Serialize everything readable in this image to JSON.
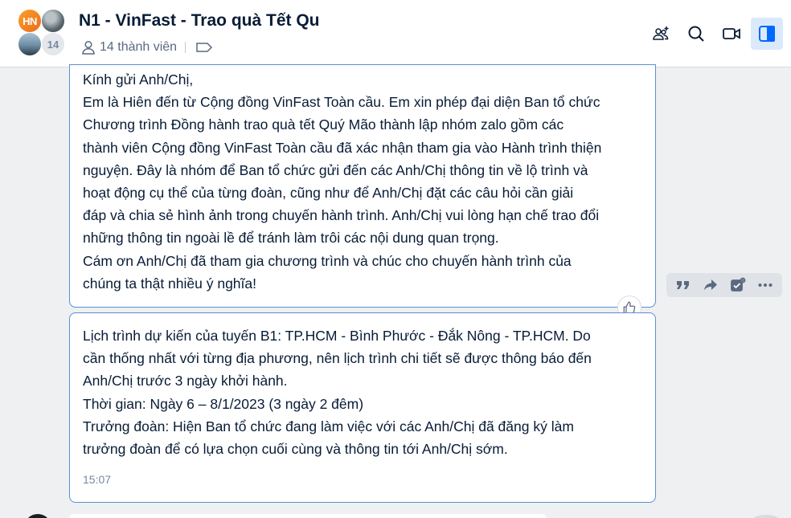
{
  "header": {
    "avatar_initials": "HN",
    "member_badge": "14",
    "title": "N1 - VinFast - Trao quà Tết Qu",
    "members_label": "14 thành viên",
    "accent_color": "#0068ff"
  },
  "messages": [
    {
      "lines": [
        "Kính gửi Anh/Chị,",
        "Em là Hiên đến từ Cộng đồng VinFast Toàn cầu. Em xin phép đại diện Ban tổ chức",
        "Chương trình Đồng hành trao quà tết Quý Mão thành lập nhóm zalo gồm các",
        "thành viên Cộng đồng VinFast Toàn cầu đã xác nhận tham gia vào Hành trình thiện",
        "nguyện. Đây là nhóm để Ban tổ chức gửi đến các Anh/Chị thông tin về lộ trình và",
        "hoạt động cụ thể của từng đoàn, cũng như để Anh/Chị đặt các câu hỏi cần giải",
        "đáp và chia sẻ hình ảnh trong chuyến hành trình. Anh/Chị vui lòng hạn chế trao đổi",
        "những thông tin ngoài lề để tránh làm trôi các nội dung quan trọng.",
        "Cám ơn Anh/Chị đã tham gia chương trình và chúc cho chuyến hành trình của",
        "chúng ta thật nhiều ý nghĩa!"
      ]
    },
    {
      "lines": [
        "Lịch trình dự kiến của tuyến B1: TP.HCM - Bình Phước - Đắk Nông - TP.HCM. Do",
        "cần thống nhất với từng địa phương, nên lịch trình chi tiết sẽ được thông báo đến",
        "Anh/Chị trước 3 ngày khởi hành.",
        "Thời gian: Ngày 6 – 8/1/2023 (3 ngày 2 đêm)",
        "Trưởng đoàn: Hiện Ban tổ chức đang làm việc với các Anh/Chị đã đăng ký làm",
        "trưởng đoàn để có lựa chọn cuối cùng và thông tin tới Anh/Chị sớm."
      ],
      "time": "15:07"
    }
  ]
}
